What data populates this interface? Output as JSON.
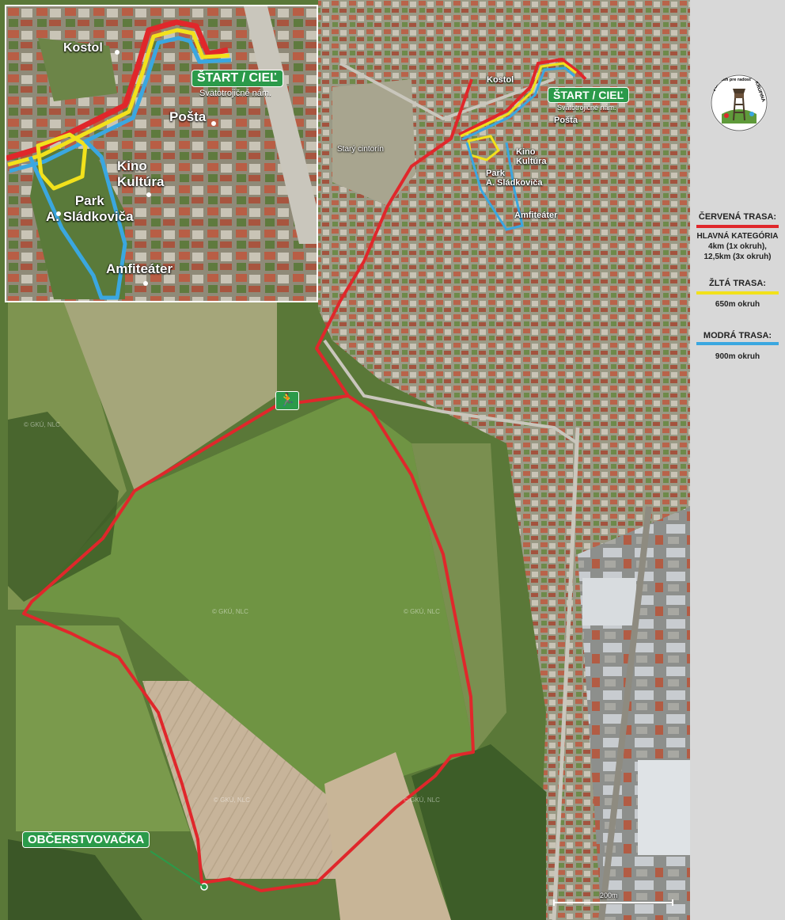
{
  "inset_labels": {
    "kostol": "Kostol",
    "start": "ŠTART / CIEĽ",
    "start_sub": "Svätotrojičné nám.",
    "posta": "Pošta",
    "kino": "Kino\nKultúra",
    "park": "Park\nA. Sládkoviča",
    "amfiteater": "Amfiteáter"
  },
  "main_labels": {
    "kostol": "Kostol",
    "start": "ŠTART / CIEĽ",
    "start_sub": "Svätotrojičné nám.",
    "posta": "Pošta",
    "stary_cintorin": "Starý cintorín",
    "kino": "Kino\nKultúra",
    "park": "Park\nA. Sládkoviča",
    "amfiteater": "Amfiteáter",
    "obcerstvovacka": "OBČERSTVOVAČKA",
    "scale": "200m",
    "copyright": "© GKÚ, NLC"
  },
  "legend": {
    "red_title": "ČERVENÁ TRASA:",
    "red_desc_1": "HLAVNÁ KATEGÓRIA",
    "red_desc_2": "4km (1x okruh),",
    "red_desc_3": "12,5km (3x okruh)",
    "yellow_title": "ŽLTÁ TRASA:",
    "yellow_desc": "650m okruh",
    "blue_title": "MODRÁ TRASA:",
    "blue_desc": "900m okruh"
  },
  "logo": {
    "text_left": "FUN RUN",
    "text_arc": "Beh pre radosť",
    "text_right": "KRUPINA"
  },
  "colors": {
    "red_route": "#e0272b",
    "yellow_route": "#f2e11c",
    "blue_route": "#3aa7e0",
    "green_tag": "#2b9a4a"
  },
  "icons": {
    "runner": "runner-icon",
    "refreshment": "refreshment-point-icon"
  }
}
